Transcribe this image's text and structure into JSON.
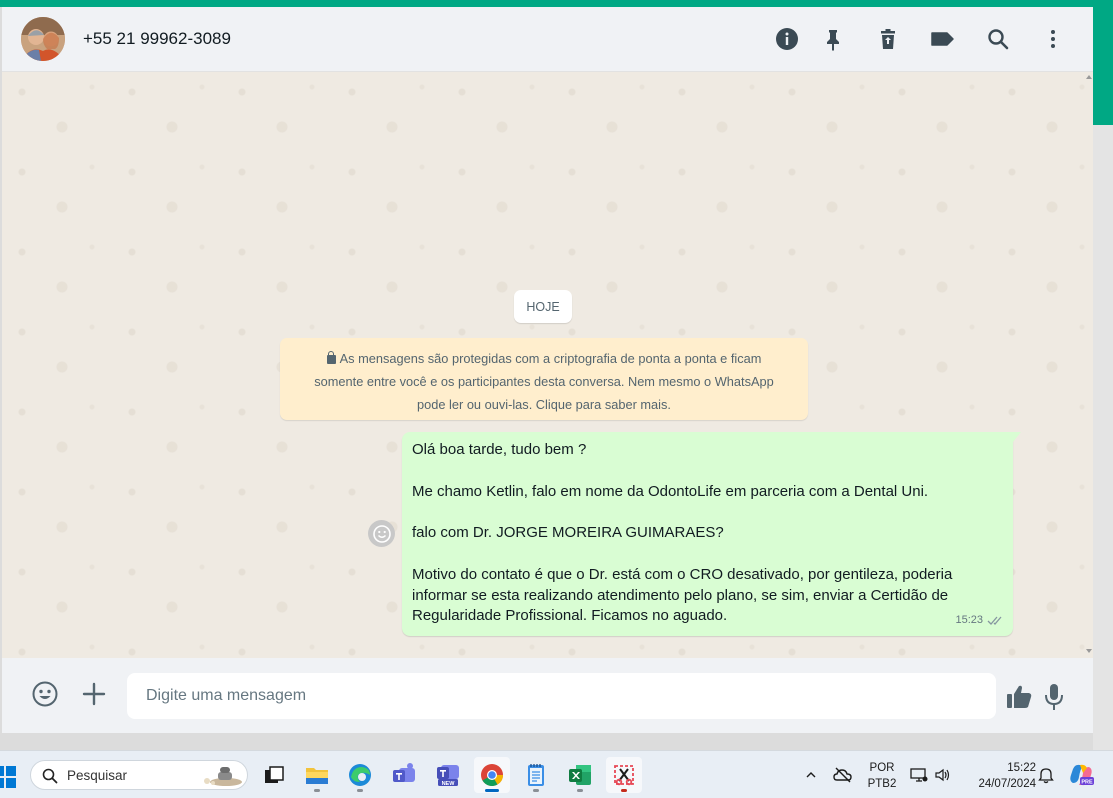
{
  "colors": {
    "accent": "#00a884",
    "bubble_out": "#d9fdd3",
    "notice_bg": "#ffeecd",
    "chat_bg": "#efeae2",
    "header_bg": "#f0f2f5"
  },
  "header": {
    "contact_name": "+55 21 99962-3089",
    "icons": [
      "info-icon",
      "pin-icon",
      "delete-icon",
      "label-icon",
      "search-icon",
      "menu-icon"
    ]
  },
  "chat": {
    "date_divider": "HOJE",
    "encryption_notice": {
      "line1": "As mensagens são protegidas com a criptografia de ponta a ponta e ficam",
      "line2": "somente entre você e os participantes desta conversa. Nem mesmo o WhatsApp",
      "line3": "pode ler ou ouvi-las. Clique para saber mais."
    },
    "message": {
      "p1": "Olá boa tarde, tudo bem ?",
      "p2": "Me chamo Ketlin, falo em nome da OdontoLife em parceria com a Dental Uni.",
      "p3": "falo com Dr. JORGE MOREIRA GUIMARAES?",
      "p4_line1": "Motivo do contato é que o Dr. está com o CRO desativado, por gentileza, poderia",
      "p4_line2": "informar se esta realizando atendimento pelo plano, se sim, enviar a Certidão de",
      "p4_line3": "Regularidade Profissional. Ficamos no aguado.",
      "time": "15:23"
    }
  },
  "composer": {
    "placeholder": "Digite uma mensagem"
  },
  "taskbar": {
    "search_label": "Pesquisar",
    "lang_top": "POR",
    "lang_bottom": "PTB2",
    "time": "15:22",
    "date": "24/07/2024",
    "teams_badge": "NEW",
    "copilot_badge": "PRE"
  }
}
